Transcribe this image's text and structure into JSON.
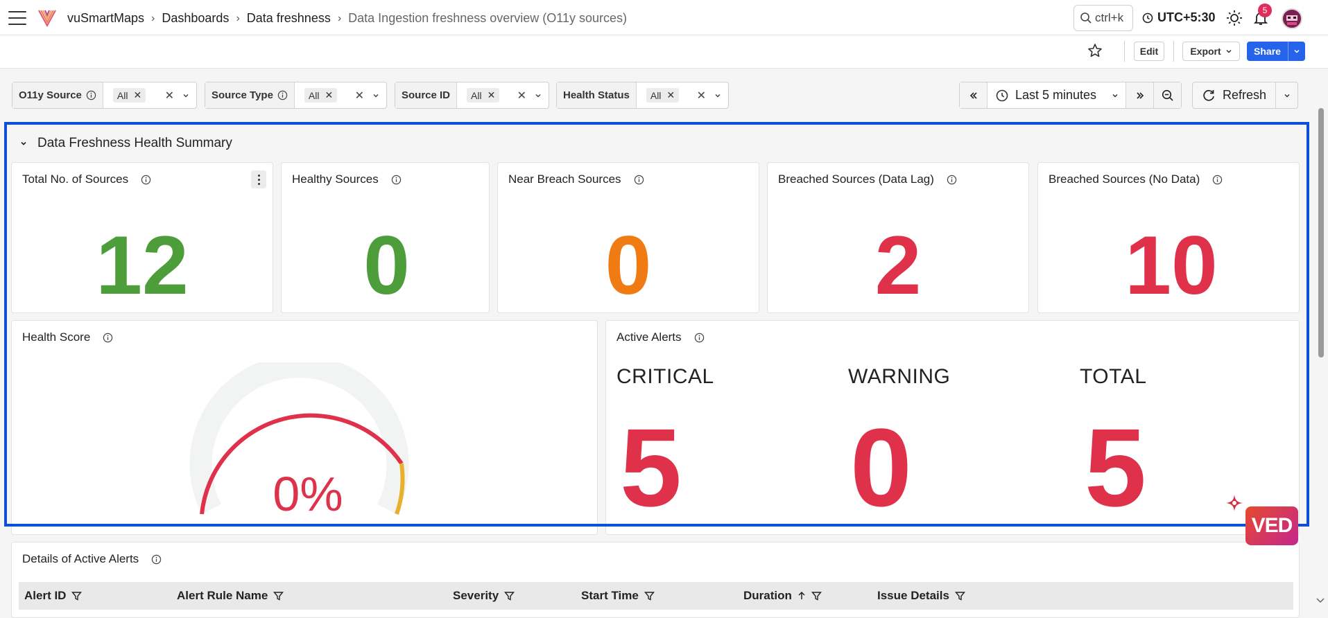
{
  "header": {
    "app_name": "vuSmartMaps",
    "breadcrumbs": [
      "Dashboards",
      "Data freshness",
      "Data Ingestion freshness overview (O11y sources)"
    ],
    "search_shortcut": "ctrl+k",
    "timezone": "UTC+5:30",
    "notification_count": "5"
  },
  "toolbar": {
    "edit_label": "Edit",
    "export_label": "Export",
    "share_label": "Share"
  },
  "filters": [
    {
      "label": "O11y Source",
      "value": "All"
    },
    {
      "label": "Source Type",
      "value": "All"
    },
    {
      "label": "Source ID",
      "value": "All"
    },
    {
      "label": "Health Status",
      "value": "All"
    }
  ],
  "time": {
    "range_label": "Last 5 minutes",
    "refresh_label": "Refresh"
  },
  "section": {
    "title": "Data Freshness Health Summary"
  },
  "stats": [
    {
      "title": "Total No. of Sources",
      "value": "12",
      "color": "#4d9e3a"
    },
    {
      "title": "Healthy Sources",
      "value": "0",
      "color": "#4d9e3a"
    },
    {
      "title": "Near Breach Sources",
      "value": "0",
      "color": "#f07b13"
    },
    {
      "title": "Breached Sources (Data Lag)",
      "value": "2",
      "color": "#e0314a"
    },
    {
      "title": "Breached Sources (No Data)",
      "value": "10",
      "color": "#e0314a"
    }
  ],
  "health_score": {
    "title": "Health Score",
    "value_label": "0%",
    "value_fraction": 0,
    "gauge_colors": {
      "critical": "#e0314a",
      "warning": "#e8b12a",
      "track": "#f2f3f3"
    }
  },
  "active_alerts": {
    "title": "Active Alerts",
    "items": [
      {
        "label": "CRITICAL",
        "value": "5"
      },
      {
        "label": "WARNING",
        "value": "0"
      },
      {
        "label": "TOTAL",
        "value": "5"
      }
    ]
  },
  "details": {
    "title": "Details of Active Alerts",
    "columns": [
      "Alert ID",
      "Alert Rule Name",
      "Severity",
      "Start Time",
      "Duration",
      "Issue Details"
    ]
  },
  "assistant": {
    "label": "VED"
  }
}
